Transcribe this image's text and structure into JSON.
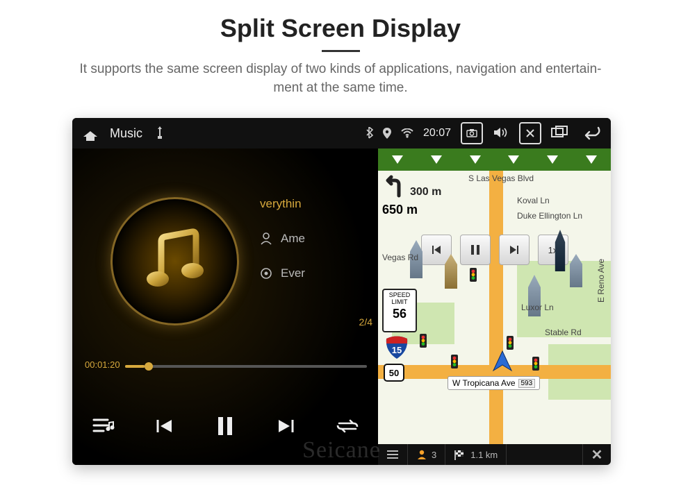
{
  "header": {
    "title": "Split Screen Display",
    "subtitle_line1": "It supports the same screen display of two kinds of applications, navigation and entertain-",
    "subtitle_line2": "ment at the same time."
  },
  "status": {
    "app_label": "Music",
    "clock": "20:07"
  },
  "music": {
    "tracks": [
      {
        "label": "verythin"
      },
      {
        "label": "Ame"
      },
      {
        "label": "Ever"
      }
    ],
    "counter": "2/4",
    "elapsed": "00:01:20"
  },
  "nav": {
    "turn1_dist": "300 m",
    "turn2_dist": "650 m",
    "speed_caption": "SPEED LIMIT",
    "speed_value": "56",
    "interstate": "15",
    "route_sign": "50",
    "playback_speed": "1x",
    "roads": {
      "blvd": "S Las Vegas Blvd",
      "koval": "Koval Ln",
      "duke": "Duke Ellington Ln",
      "vegas_rd": "Vegas Rd",
      "luxor": "Luxor Ln",
      "stable": "Stable Rd",
      "reno": "E Reno Ave",
      "tropicana": "W Tropicana Ave",
      "tropicana_badge": "593"
    },
    "footer": {
      "person_count": "3",
      "route_dist": "1.1 km"
    }
  },
  "watermark": "Seicane"
}
